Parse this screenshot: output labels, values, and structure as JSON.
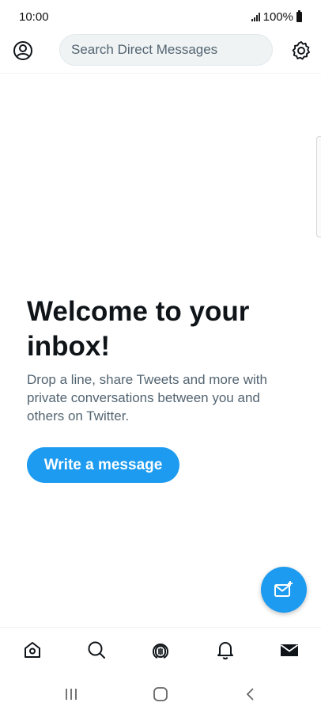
{
  "status_bar": {
    "time": "10:00",
    "battery_text": "100%"
  },
  "header": {
    "avatar_icon": "profile-icon",
    "search_placeholder": "Search Direct Messages",
    "settings_icon": "gear-icon"
  },
  "welcome": {
    "title": "Welcome to your inbox!",
    "body": "Drop a line, share Tweets and more with private conversations between you and others on Twitter.",
    "button_label": "Write a message"
  },
  "fab": {
    "icon": "new-message-icon"
  },
  "tabbar": {
    "items": [
      {
        "name": "home",
        "icon": "home-icon"
      },
      {
        "name": "search",
        "icon": "search-icon"
      },
      {
        "name": "spaces",
        "icon": "spaces-icon"
      },
      {
        "name": "notifications",
        "icon": "bell-icon"
      },
      {
        "name": "messages",
        "icon": "mail-icon",
        "active": true
      }
    ]
  },
  "android_nav": {
    "items": [
      "recents-icon",
      "home-circle-icon",
      "back-icon"
    ]
  },
  "colors": {
    "accent": "#1d9bf0",
    "text_primary": "#0f1419",
    "text_secondary": "#536471"
  }
}
